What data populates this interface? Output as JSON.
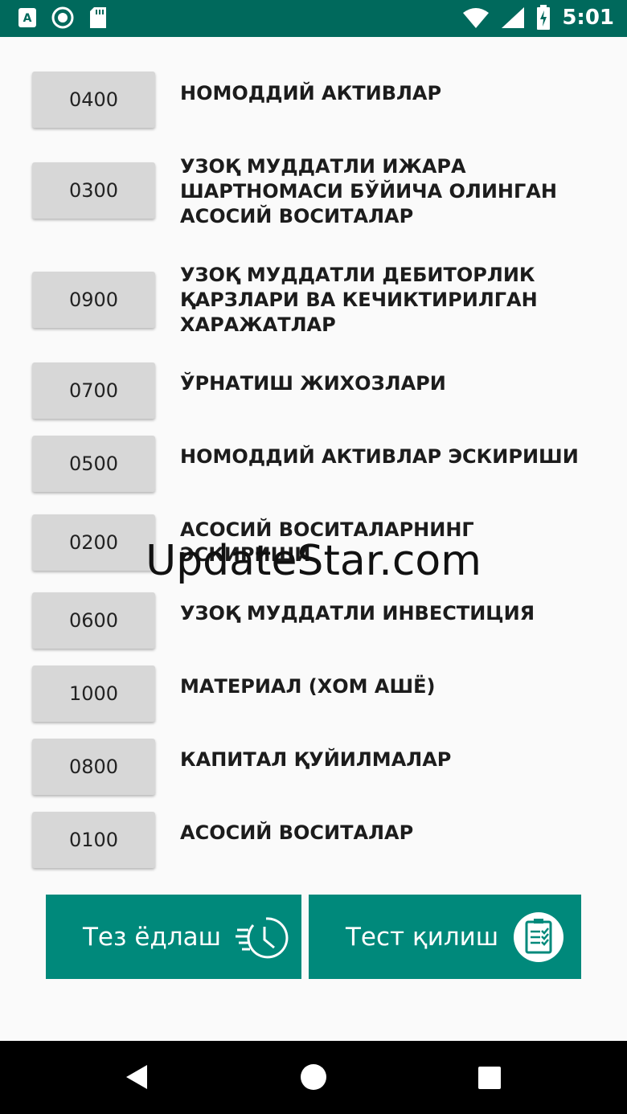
{
  "status_bar": {
    "time": "5:01",
    "icons": [
      "app-a-icon",
      "record-icon",
      "sd-card-icon",
      "wifi-icon",
      "signal-icon",
      "battery-charging-icon"
    ]
  },
  "accounts": [
    {
      "code": "0400",
      "name": "НОМОДДИЙ АКТИВЛАР"
    },
    {
      "code": "0300",
      "name": "УЗОҚ МУДДАТЛИ ИЖАРА ШАРТНОМАСИ БЎЙИЧА ОЛИНГАН АСОСИЙ ВОСИТАЛАР"
    },
    {
      "code": "0900",
      "name": "УЗОҚ МУДДАТЛИ ДЕБИТОРЛИК ҚАРЗЛАРИ ВА КЕЧИКТИРИЛГАН ХАРАЖАТЛАР"
    },
    {
      "code": "0700",
      "name": "ЎРНАТИШ ЖИХОЗЛАРИ"
    },
    {
      "code": "0500",
      "name": "НОМОДДИЙ АКТИВЛАР ЭСКИРИШИ"
    },
    {
      "code": "0200",
      "name": "АСОСИЙ ВОСИТАЛАРНИНГ ЭСКИРИШИ"
    },
    {
      "code": "0600",
      "name": "УЗОҚ МУДДАТЛИ ИНВЕСТИЦИЯ"
    },
    {
      "code": "1000",
      "name": "МАТЕРИАЛ (ХОМ АШЁ)"
    },
    {
      "code": "0800",
      "name": "КАПИТАЛ ҚУЙИЛМАЛАР"
    },
    {
      "code": "0100",
      "name": "АСОСИЙ ВОСИТАЛАР"
    }
  ],
  "actions": {
    "speed_learn": "Тез ёдлаш",
    "test": "Тест қилиш"
  },
  "watermark": "UpdateStar.com",
  "colors": {
    "status_bar": "#00695c",
    "accent": "#00897b",
    "code_button": "#d7d7d7"
  }
}
